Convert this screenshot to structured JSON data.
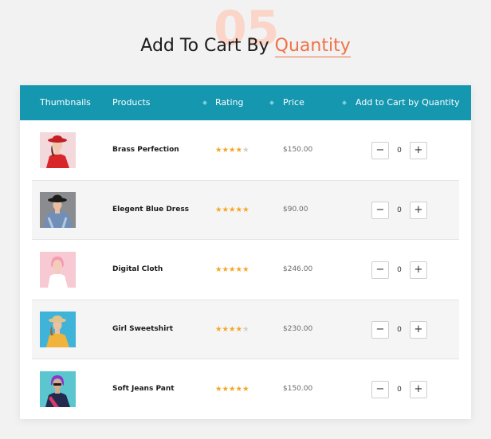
{
  "section": {
    "number": "05",
    "title_prefix": "Add To Cart By",
    "title_accent": "Quantity",
    "accent_color": "#f07146"
  },
  "table": {
    "header_color": "#1597b0",
    "columns": [
      "Thumbnails",
      "Products",
      "Rating",
      "Price",
      "Add to Cart by Quantity"
    ],
    "rows": [
      {
        "product": "Brass Perfection",
        "rating": 4,
        "price": "$150.00",
        "qty": "0",
        "thumb": "woman-red-hat-photo"
      },
      {
        "product": "Elegent Blue Dress",
        "rating": 5,
        "price": "$90.00",
        "qty": "0",
        "thumb": "woman-black-hat-photo"
      },
      {
        "product": "Digital Cloth",
        "rating": 5,
        "price": "$246.00",
        "qty": "0",
        "thumb": "woman-pink-hair-photo"
      },
      {
        "product": "Girl Sweetshirt",
        "rating": 4,
        "price": "$230.00",
        "qty": "0",
        "thumb": "woman-straw-hat-photo"
      },
      {
        "product": "Soft Jeans Pant",
        "rating": 5,
        "price": "$150.00",
        "qty": "0",
        "thumb": "woman-purple-hair-photo"
      }
    ],
    "minus_glyph": "−",
    "plus_glyph": "+"
  }
}
